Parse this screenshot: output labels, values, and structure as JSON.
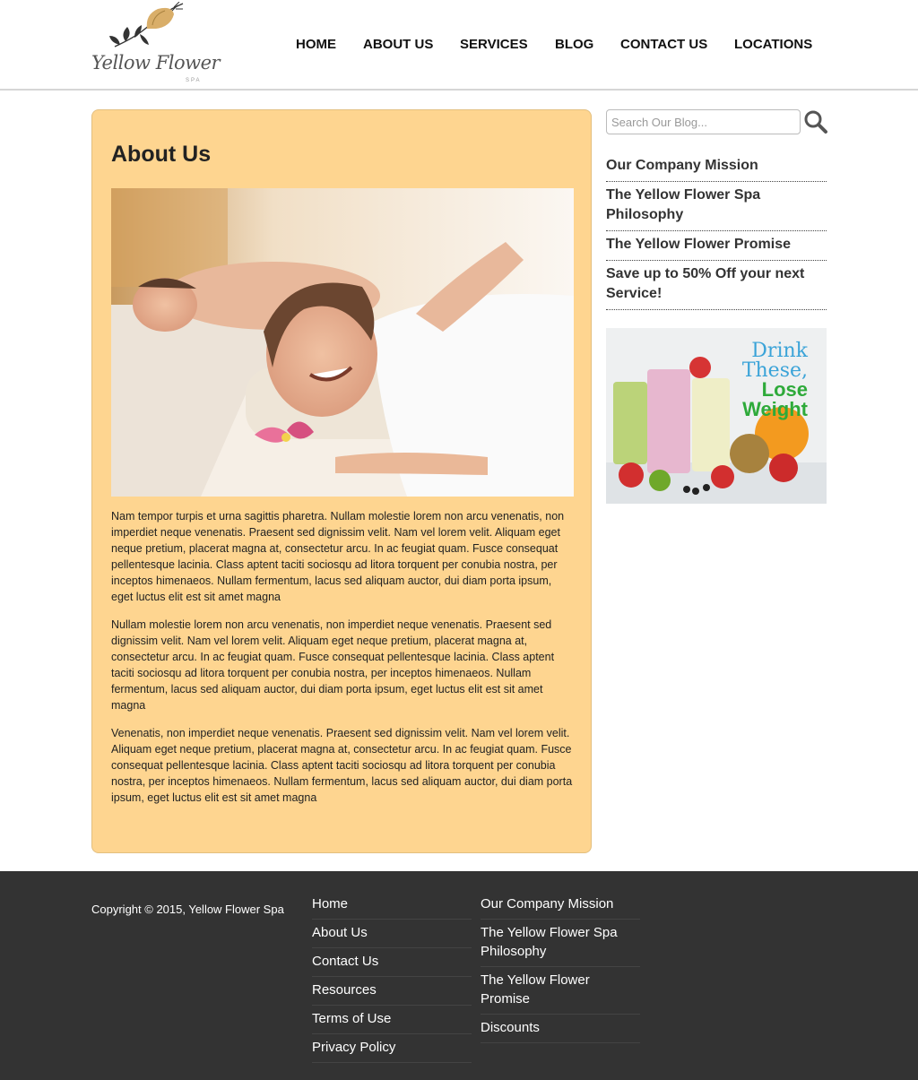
{
  "brand": {
    "name": "Yellow Flower",
    "sub": "SPA"
  },
  "nav": [
    "HOME",
    "ABOUT US",
    "SERVICES",
    "BLOG",
    "CONTACT US",
    "LOCATIONS"
  ],
  "main": {
    "title": "About Us",
    "paragraphs": [
      "Nam tempor turpis et urna sagittis pharetra. Nullam molestie lorem non arcu venenatis, non imperdiet neque venenatis. Praesent sed dignissim velit. Nam vel lorem velit. Aliquam eget neque pretium, placerat magna at, consectetur arcu. In ac feugiat quam. Fusce consequat pellentesque lacinia. Class aptent taciti sociosqu ad litora torquent per conubia nostra, per inceptos himenaeos. Nullam fermentum, lacus sed aliquam auctor, dui diam porta ipsum, eget luctus elit est sit amet magna",
      "Nullam molestie lorem non arcu venenatis, non imperdiet neque venenatis. Praesent sed dignissim velit. Nam vel lorem velit. Aliquam eget neque pretium, placerat magna at, consectetur arcu. In ac feugiat quam. Fusce consequat pellentesque lacinia. Class aptent taciti sociosqu ad litora torquent per conubia nostra, per inceptos himenaeos. Nullam fermentum, lacus sed aliquam auctor, dui diam porta ipsum, eget luctus elit est sit amet magna",
      "Venenatis, non imperdiet neque venenatis. Praesent sed dignissim velit. Nam vel lorem velit. Aliquam eget neque pretium, placerat magna at, consectetur arcu. In ac feugiat quam. Fusce consequat pellentesque lacinia. Class aptent taciti sociosqu ad litora torquent per conubia nostra, per inceptos himenaeos. Nullam fermentum, lacus sed aliquam auctor, dui diam porta ipsum, eget luctus elit est sit amet magna"
    ]
  },
  "sidebar": {
    "search_placeholder": "Search Our Blog...",
    "links": [
      "Our Company Mission",
      "The Yellow Flower Spa Philosophy",
      "The Yellow Flower Promise",
      "Save up to 50% Off your next Service!"
    ],
    "ad": {
      "line1": "Drink",
      "line2": "These,",
      "line3": "Lose",
      "line4": "Weight"
    }
  },
  "footer": {
    "copyright": "Copyright © 2015, Yellow Flower Spa",
    "col1": [
      "Home",
      "About Us",
      "Contact Us",
      "Resources",
      "Terms of Use",
      "Privacy Policy"
    ],
    "col2": [
      "Our Company Mission",
      "The Yellow Flower Spa Philosophy",
      "The Yellow Flower Promise",
      "Discounts"
    ]
  },
  "colors": {
    "card_bg": "#fed590",
    "footer_bg": "#333333",
    "ad_blue": "#3aa3d8",
    "ad_green": "#2eaa3a"
  }
}
